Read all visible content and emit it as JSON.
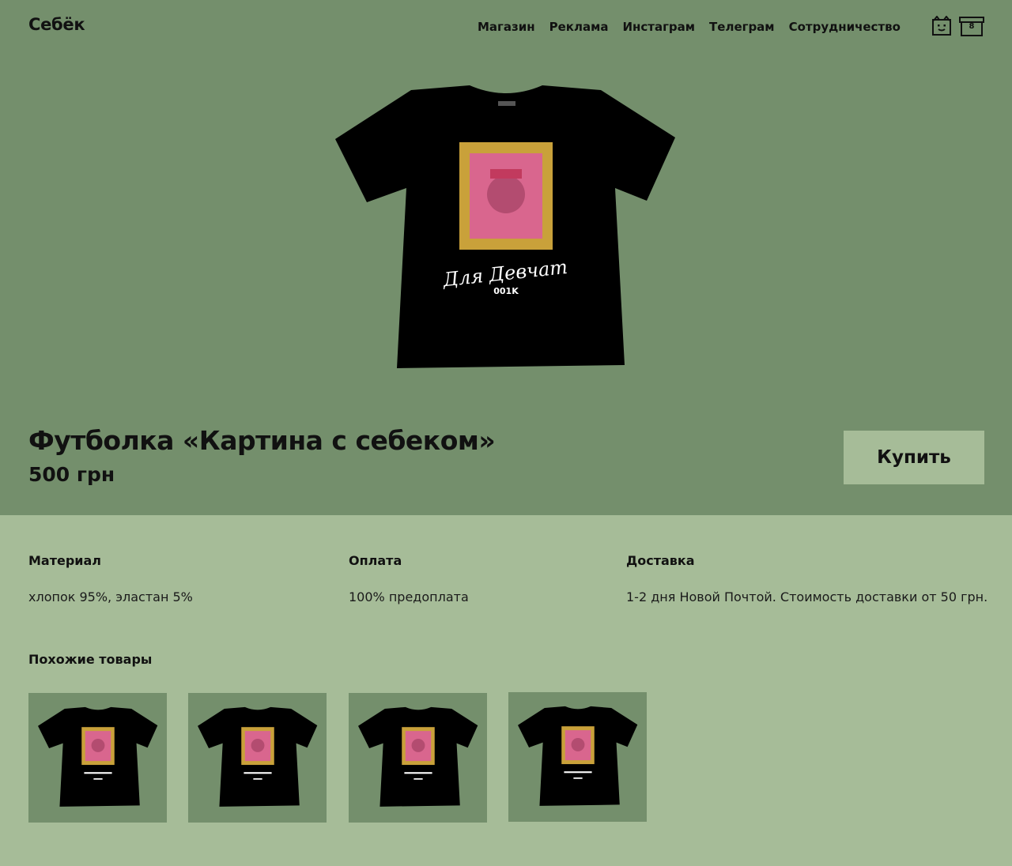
{
  "header": {
    "logo": "Себёк",
    "nav": [
      "Магазин",
      "Реклама",
      "Инстаграм",
      "Телеграм",
      "Сотрудничество"
    ],
    "cart_count": "8"
  },
  "product": {
    "title": "Футболка «Картина с себеком»",
    "price": "500 грн",
    "buy_label": "Купить",
    "shirt_caption": "Для Девчат",
    "shirt_code": "001K"
  },
  "info": [
    {
      "label": "Материал",
      "value": "хлопок 95%, эластан 5%"
    },
    {
      "label": "Оплата",
      "value": "100% предоплата"
    },
    {
      "label": "Доставка",
      "value": "1-2 дня Новой Почтой. Стоимость доставки от 50 грн."
    }
  ],
  "similar": {
    "title": "Похожие товары",
    "count": 4
  },
  "colors": {
    "hero_bg": "#748f6c",
    "page_bg": "#a6bc98",
    "button_bg": "#a6bc98",
    "shirt": "#000000",
    "frame": "#c9a13a",
    "artwork": "#d9668e"
  },
  "icons": [
    "user-icon",
    "cart-icon"
  ]
}
